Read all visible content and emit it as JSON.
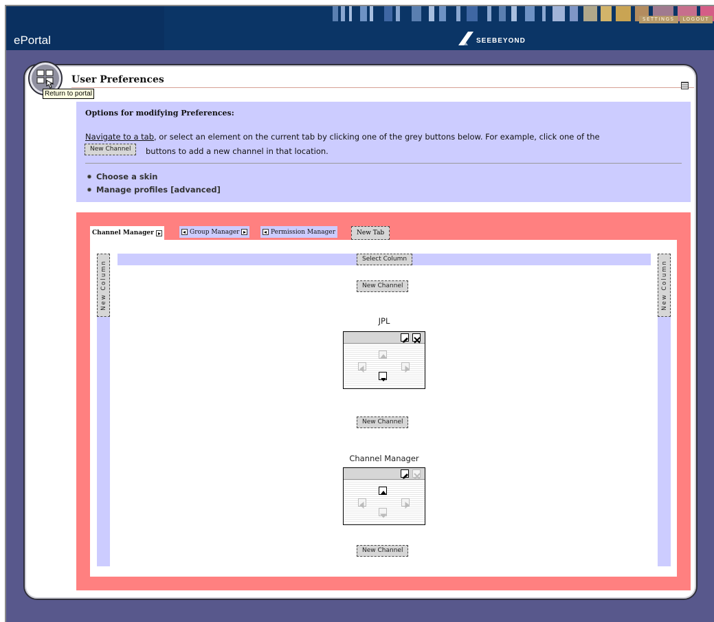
{
  "header": {
    "app_title": "ePortal",
    "brand": "SeeBeyond",
    "brand_display": "SEEBEYOND",
    "nav": {
      "settings": "SETTINGS",
      "logout": "LOGOUT"
    }
  },
  "portal_button": {
    "tooltip": "Return to portal"
  },
  "page": {
    "title": "User Preferences"
  },
  "options": {
    "heading": "Options for modifying Preferences:",
    "instruction_link": "Navigate to a tab",
    "instruction_rest": ", or select an element on the current tab by clicking one of the grey buttons below. For example, click one of the",
    "instruction_button": "New Channel",
    "instruction_end": "buttons to add a new channel in that location.",
    "items": [
      "Choose a skin",
      "Manage profiles [advanced]"
    ]
  },
  "tabs": [
    {
      "label": "Channel Manager",
      "active": true
    },
    {
      "label": "Group Manager",
      "active": false
    },
    {
      "label": "Permission Manager",
      "active": false
    }
  ],
  "new_tab_label": "New Tab",
  "column": {
    "new_column_label": "New Column",
    "select_column_label": "Select Column",
    "new_channel_label": "New Channel"
  },
  "channels": [
    {
      "title": "JPL"
    },
    {
      "title": "Channel Manager"
    }
  ],
  "colors": {
    "header_bg": "#0b3566",
    "frame_bg": "#58588c",
    "options_bg": "#ccccff",
    "tab_area_bg": "#ff8080",
    "button_bg": "#d6d6d6"
  }
}
